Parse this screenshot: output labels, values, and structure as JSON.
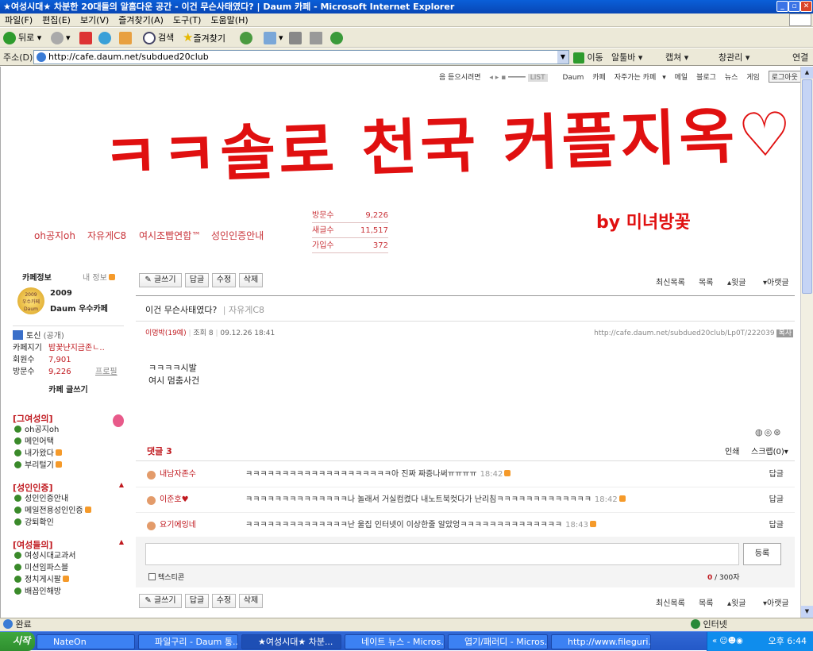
{
  "window": {
    "title": "★여성시대★ 차분한 20대들의 알흠다운 공간 - 이건 무슨사태였다? | Daum 카페 - Microsoft Internet Explorer"
  },
  "menu": [
    "파일(F)",
    "편집(E)",
    "보기(V)",
    "즐겨찾기(A)",
    "도구(T)",
    "도움말(H)"
  ],
  "toolbar": {
    "back": "뒤로",
    "search": "검색",
    "favorites": "즐겨찾기"
  },
  "address": {
    "label": "주소(D)",
    "url": "http://cafe.daum.net/subdued20club",
    "go": "이동",
    "alttoolbar": "알툴바",
    "capture": "캡쳐",
    "window_mgr": "창관리",
    "links": "연결"
  },
  "page": {
    "top_nav": [
      "음 듣으시려면",
      "Daum",
      "카페",
      "자주가는 카페",
      "메일",
      "블로그",
      "뉴스",
      "게임"
    ],
    "logout": "로그아웃",
    "banner_text": "ㅋㅋ솔로 천국 커플지옥♡",
    "banner_sign": "by 미녀방꽃",
    "categories": [
      "oh공지oh",
      "자유게C8",
      "여시조빱연합™",
      "성인인증안내"
    ],
    "stats": [
      {
        "label": "방문수",
        "value": "9,226"
      },
      {
        "label": "새글수",
        "value": "11,517"
      },
      {
        "label": "가입수",
        "value": "372"
      }
    ],
    "sidebar": {
      "tab_cafe": "카페정보",
      "tab_my": "내 정보",
      "award_year": "2009",
      "award_title": "Daum 우수카페",
      "badge_line1": "2009",
      "badge_line2": "우수카페",
      "badge_line3": "Daum",
      "level": "토신",
      "level_public": "(공개)",
      "manager_label": "카페지기",
      "manager_value": "밤꽃냔지금존ㄴ..",
      "members_label": "회원수",
      "members_value": "7,901",
      "visits_label": "방문수",
      "visits_value": "9,226",
      "profile": "프로필",
      "write": "카페 글쓰기",
      "groups": [
        {
          "title": "[그여성의]",
          "items": [
            "oh공지oh",
            "메인어택",
            "내가왔다",
            "부리털기"
          ]
        },
        {
          "title": "[성인인증]",
          "items": [
            "성인인증안내",
            "메일전용성인인증",
            "강퇴확인"
          ]
        },
        {
          "title": "[여성들의]",
          "items": [
            "여성시대교과서",
            "미션임파스블",
            "정치게시팔",
            "배꼽인해방"
          ]
        }
      ]
    },
    "post": {
      "buttons": [
        "글쓰기",
        "답글",
        "수정",
        "삭제"
      ],
      "right_links": [
        "최신목록",
        "목록",
        "▴윗글",
        "▾아랫글"
      ],
      "title": "이건 무슨사태였다?",
      "board": "자유게C8",
      "author": "이멍박(19예)",
      "views": "조회 8",
      "date": "09.12.26 18:41",
      "link": "http://cafe.daum.net/subdued20club/Lp0T/222039",
      "copy": "복사",
      "body_line1": "ㅋㅋㅋㅋ시발",
      "body_line2": "여시 멈춤사건",
      "comment_count_label": "댓글 3",
      "print": "인쇄",
      "scrap": "스크랩(0)▾"
    },
    "comments": [
      {
        "author": "내남자존수",
        "text": "ㅋㅋㅋㅋㅋㅋㅋㅋㅋㅋㅋㅋㅋㅋㅋㅋㅋㅋㅋㅋ아 진짜 짜증나써ㅠㅠㅠㅠ",
        "time": "18:42",
        "reply": "답글"
      },
      {
        "author": "이준호♥",
        "text": "ㅋㅋㅋㅋㅋㅋㅋㅋㅋㅋㅋㅋㅋㅋ나 놀래서 거실컴켰다 내노트북컷다가 난리침ㅋㅋㅋㅋㅋㅋㅋㅋㅋㅋㅋㅋㅋ",
        "time": "18:42",
        "reply": "답글"
      },
      {
        "author": "요기에잉네",
        "text": "ㅋㅋㅋㅋㅋㅋㅋㅋㅋㅋㅋㅋㅋㅋ난 울집 인터넷이 이상한줄 알았엉ㅋㅋㅋㅋㅋㅋㅋㅋㅋㅋㅋㅋㅋㅋ",
        "time": "18:43",
        "reply": "답글"
      }
    ],
    "comment_box": {
      "submit": "등록",
      "emoticon": "텍스티콘",
      "count": "0",
      "max": "/ 300자"
    }
  },
  "status": {
    "text": "완료",
    "zone": "인터넷"
  },
  "taskbar": {
    "start": "시작",
    "tasks": [
      "NateOn",
      "파일구리 - Daum 통...",
      "★여성시대★ 차분...",
      "네이트 뉴스 - Micros...",
      "엽기/패러디 - Micros...",
      "http://www.fileguri.c..."
    ],
    "clock": "오후 6:44"
  },
  "colors": {
    "accent_red": "#c9343a",
    "banner_red": "#e01010",
    "xp_blue": "#0a5fd8"
  }
}
